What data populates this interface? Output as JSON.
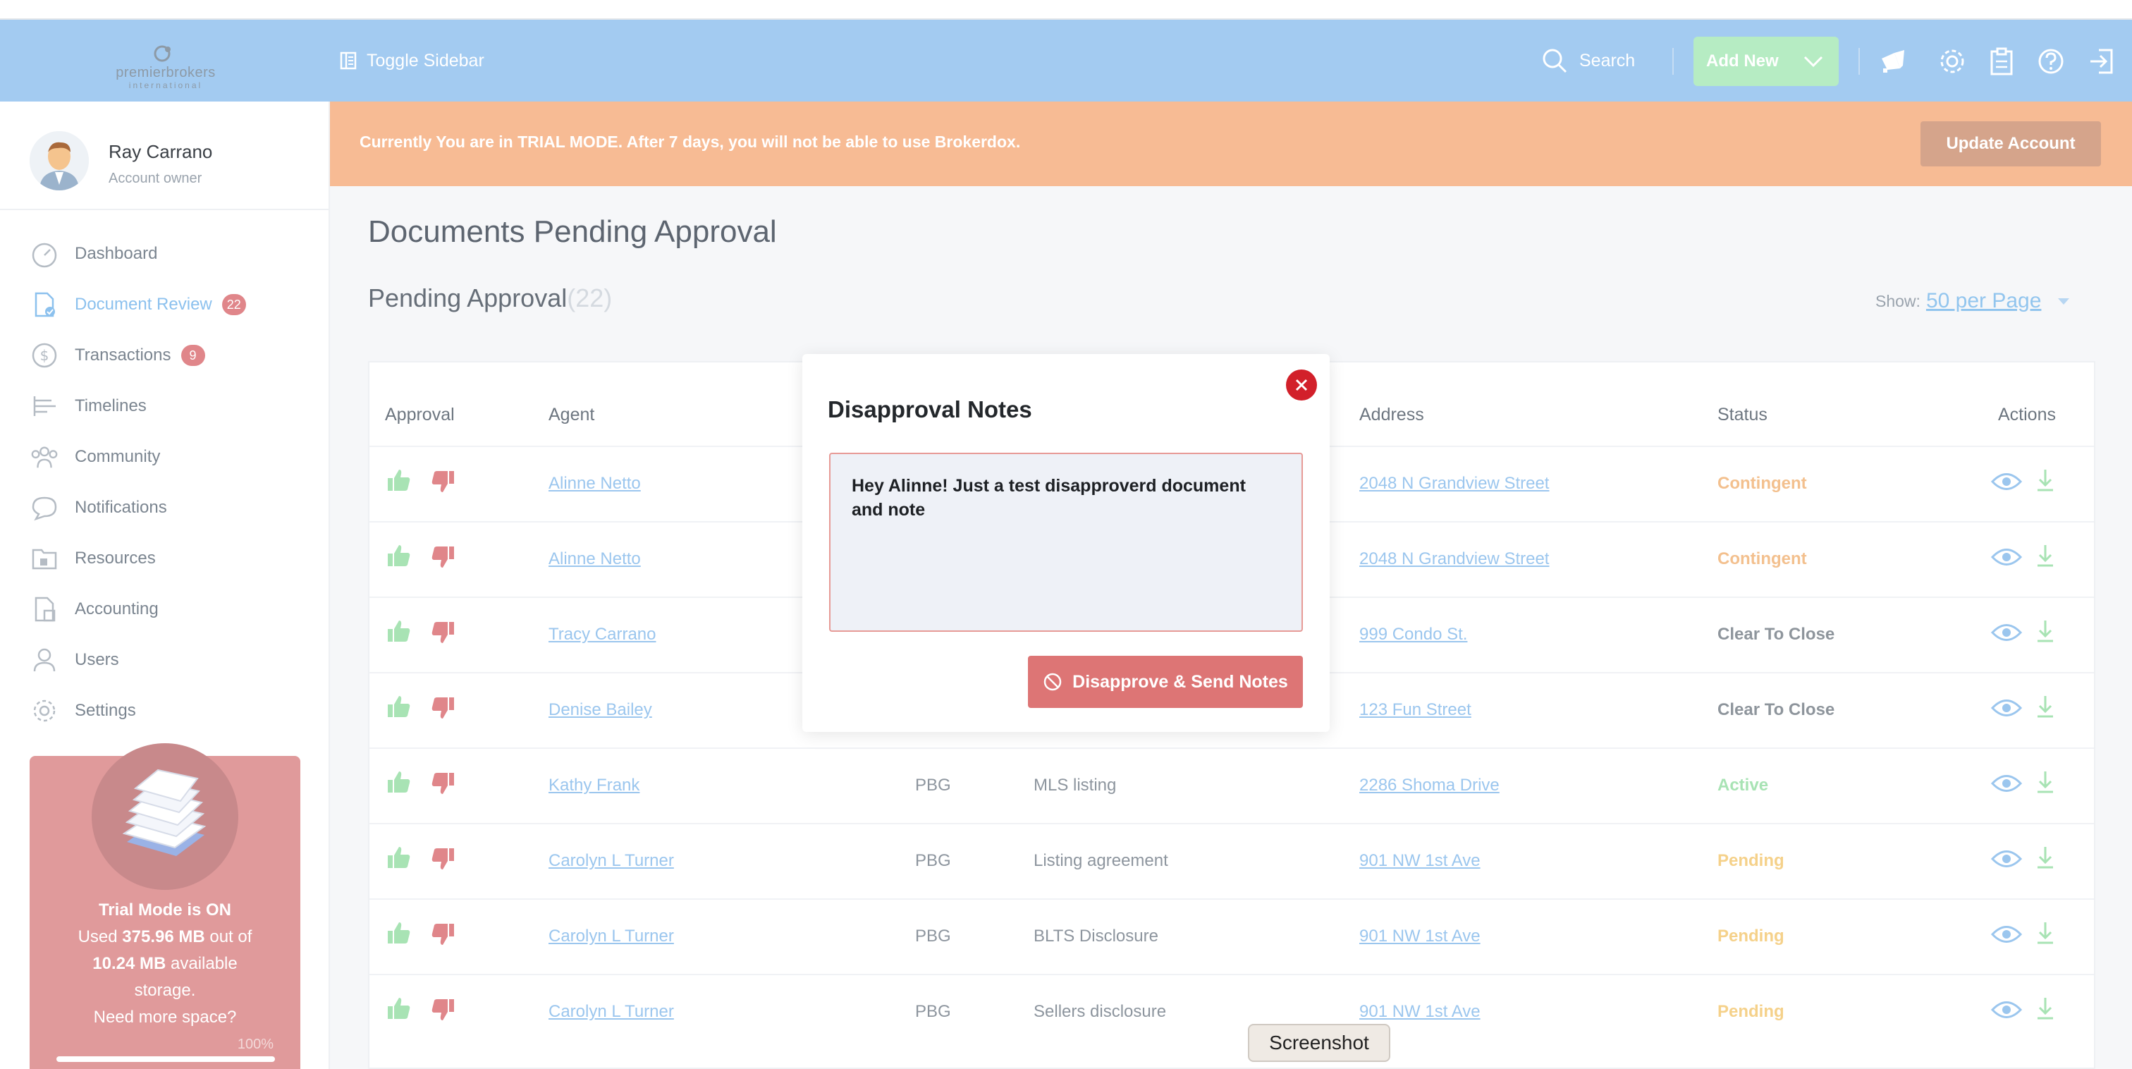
{
  "header": {
    "logo_text": "premierbrokers",
    "logo_sub": "international",
    "toggle_sidebar": "Toggle Sidebar",
    "search": "Search",
    "add_new": "Add New",
    "accent": "#a3cbf1"
  },
  "profile": {
    "name": "Ray Carrano",
    "role": "Account owner"
  },
  "nav": [
    {
      "label": "Dashboard",
      "icon": "speedometer-icon"
    },
    {
      "label": "Document Review",
      "icon": "document-check-icon",
      "badge": "22",
      "active": true
    },
    {
      "label": "Transactions",
      "icon": "dollar-icon",
      "badge": "9"
    },
    {
      "label": "Timelines",
      "icon": "timeline-icon"
    },
    {
      "label": "Community",
      "icon": "community-icon"
    },
    {
      "label": "Notifications",
      "icon": "chat-bubble-icon"
    },
    {
      "label": "Resources",
      "icon": "folder-icon"
    },
    {
      "label": "Accounting",
      "icon": "accounting-icon"
    },
    {
      "label": "Users",
      "icon": "user-icon"
    },
    {
      "label": "Settings",
      "icon": "gear-icon"
    }
  ],
  "trial_card": {
    "line1": "Trial Mode is ON",
    "line2_pre": "Used ",
    "used": "375.96 MB",
    "line2_post": " out of",
    "total": "10.24 MB",
    "line3_post": " available",
    "line4": "storage.",
    "line5": "Need more space?",
    "percent": "100%",
    "progress": 1.0
  },
  "banner": {
    "text": "Currently You are in TRIAL MODE. After 7 days, you will not be able to use Brokerdox.",
    "button": "Update Account"
  },
  "main": {
    "title": "Documents Pending Approval",
    "section": "Pending Approval",
    "count": "(22)",
    "show_label": "Show:",
    "show_value": "50 per Page"
  },
  "table": {
    "headers": {
      "approval": "Approval",
      "agent": "Agent",
      "address": "Address",
      "status": "Status",
      "actions": "Actions"
    },
    "rows": [
      {
        "agent": "Alinne Netto",
        "office": "",
        "doc": "",
        "address": "2048 N Grandview Street",
        "status": "Contingent",
        "kind": "contingent"
      },
      {
        "agent": "Alinne Netto",
        "office": "",
        "doc": "",
        "address": "2048 N Grandview Street",
        "status": "Contingent",
        "kind": "contingent"
      },
      {
        "agent": "Tracy Carrano",
        "office": "",
        "doc": "",
        "address": "999 Condo St.",
        "status": "Clear To Close",
        "kind": "clear"
      },
      {
        "agent": "Denise Bailey",
        "office": "",
        "doc": "",
        "address": "123 Fun Street",
        "status": "Clear To Close",
        "kind": "clear"
      },
      {
        "agent": "Kathy Frank",
        "office": "PBG",
        "doc": "MLS listing",
        "address": "2286 Shoma Drive",
        "status": "Active",
        "kind": "active"
      },
      {
        "agent": "Carolyn L Turner",
        "office": "PBG",
        "doc": "Listing agreement",
        "address": "901 NW 1st Ave",
        "status": "Pending",
        "kind": "pending"
      },
      {
        "agent": "Carolyn L Turner",
        "office": "PBG",
        "doc": "BLTS Disclosure",
        "address": "901 NW 1st Ave",
        "status": "Pending",
        "kind": "pending"
      },
      {
        "agent": "Carolyn L Turner",
        "office": "PBG",
        "doc": "Sellers disclosure",
        "address": "901 NW 1st Ave",
        "status": "Pending",
        "kind": "pending"
      }
    ]
  },
  "modal": {
    "title": "Disapproval Notes",
    "notes_value": "Hey Alinne! Just a test disapproverd document and note",
    "submit": "Disapprove & Send Notes"
  },
  "tooltip": {
    "text": "Screenshot"
  }
}
